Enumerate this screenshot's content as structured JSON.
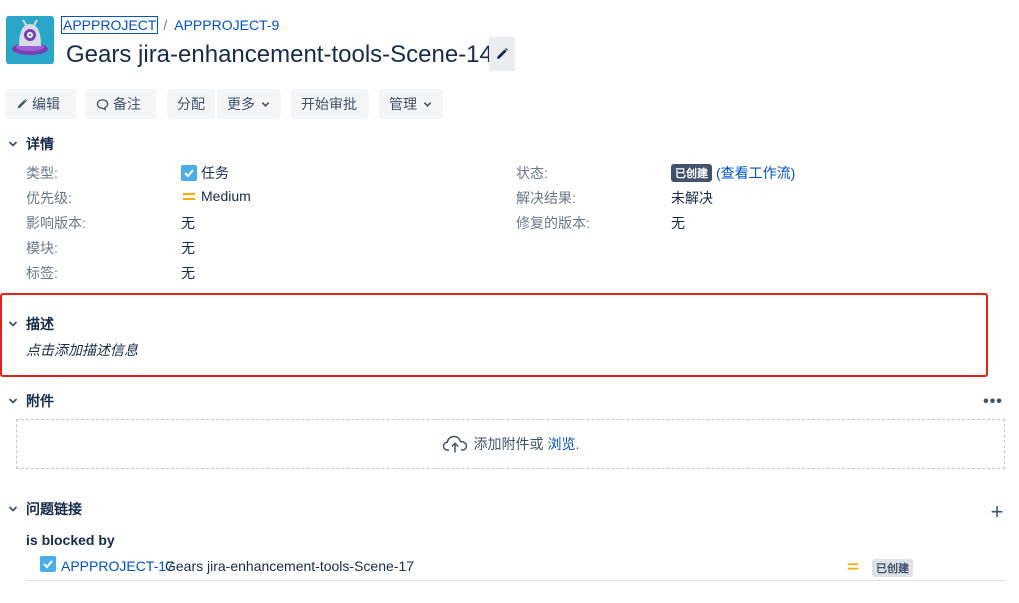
{
  "breadcrumb": {
    "project": "APPPROJECT",
    "separator": "/",
    "issue_key": "APPPROJECT-9"
  },
  "issue": {
    "title": "Gears jira-enhancement-tools-Scene-14"
  },
  "toolbar": {
    "edit": "编辑",
    "comment": "备注",
    "assign": "分配",
    "more": "更多",
    "start_review": "开始审批",
    "manage": "管理"
  },
  "details": {
    "heading": "详情",
    "left": [
      {
        "label": "类型:",
        "value": "任务",
        "icon": "task-check-icon"
      },
      {
        "label": "优先级:",
        "value": "Medium",
        "icon": "priority-medium-icon"
      },
      {
        "label": "影响版本:",
        "value": "无"
      },
      {
        "label": "模块:",
        "value": "无"
      },
      {
        "label": "标签:",
        "value": "无"
      }
    ],
    "right": [
      {
        "label": "状态:",
        "status": "已创建",
        "workflow_link": "(查看工作流)"
      },
      {
        "label": "解决结果:",
        "value": "未解决"
      },
      {
        "label": "修复的版本:",
        "value": "无"
      }
    ]
  },
  "description": {
    "heading": "描述",
    "placeholder": "点击添加描述信息"
  },
  "attachments": {
    "heading": "附件",
    "more": "•••",
    "drop_text": "添加附件或",
    "browse": "浏览."
  },
  "issue_links": {
    "heading": "问题链接",
    "add": "+",
    "type": "is blocked by",
    "items": [
      {
        "key": "APPPROJECT-17",
        "summary": "Gears jira-enhancement-tools-Scene-17",
        "status": "已创建"
      }
    ]
  },
  "colors": {
    "accent": "#0052cc",
    "highlight_border": "#e62117",
    "priority_medium": "#ffab00"
  }
}
